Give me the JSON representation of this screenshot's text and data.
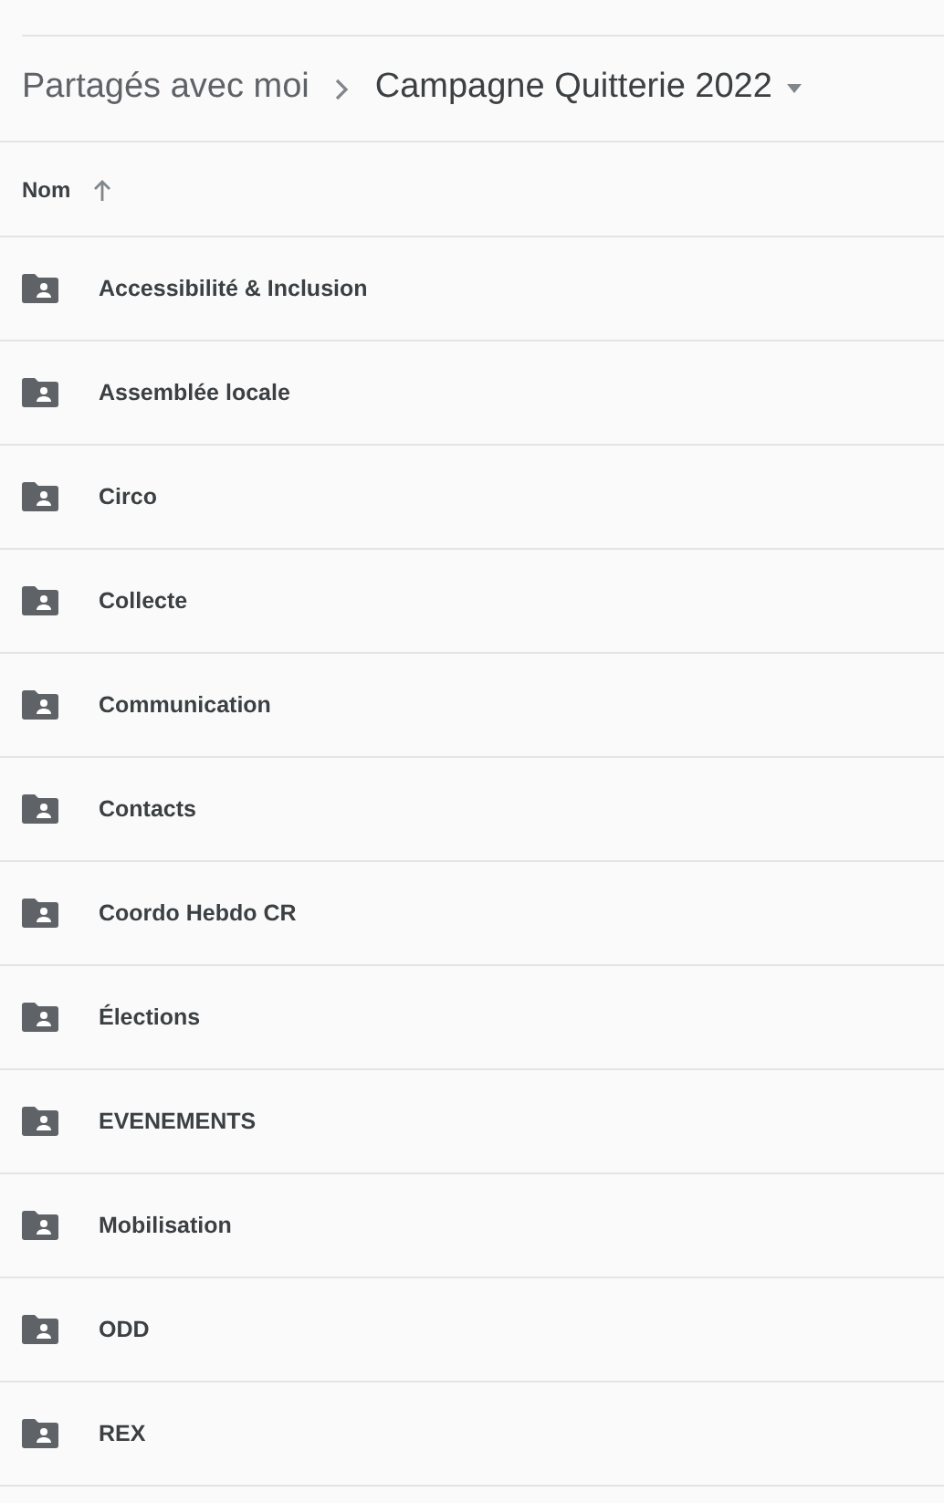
{
  "breadcrumb": [
    {
      "label": "Partagés avec moi"
    },
    {
      "label": "Campagne Quitterie 2022"
    }
  ],
  "table": {
    "columns": [
      {
        "label": "Nom"
      }
    ],
    "rows": [
      {
        "name": "Accessibilité & Inclusion"
      },
      {
        "name": "Assemblée locale"
      },
      {
        "name": "Circo"
      },
      {
        "name": "Collecte"
      },
      {
        "name": "Communication"
      },
      {
        "name": "Contacts"
      },
      {
        "name": "Coordo Hebdo CR"
      },
      {
        "name": "Élections"
      },
      {
        "name": "EVENEMENTS"
      },
      {
        "name": "Mobilisation"
      },
      {
        "name": "ODD"
      },
      {
        "name": "REX"
      }
    ]
  }
}
